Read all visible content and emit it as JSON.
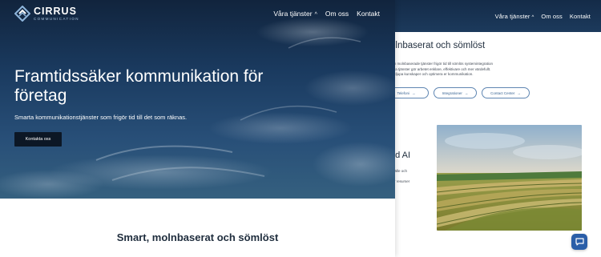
{
  "front": {
    "logo": {
      "name": "CIRRUS",
      "tagline": "COMMUNICATION"
    },
    "nav": {
      "services": "Våra tjänster",
      "about": "Om oss",
      "contact": "Kontakt"
    },
    "hero": {
      "title": "Framtidssäker kommunikation för företag",
      "lead": "Smarta kommunikationstjänster som frigör tid till det som räknas.",
      "cta": "Kontakta oss"
    },
    "section_title": "Smart, molnbaserat och sömlöst"
  },
  "back": {
    "nav": {
      "services": "Våra tjänster",
      "about": "Om oss",
      "contact": "Kontakt"
    },
    "heading": "olnbaserat och sömlöst",
    "body_lines": [
      "och molnbaserade tjänster frigör tid till sömlös systemintegration",
      "våra tjänster gör arbetet enklare, effektivare och mer värdefullt.",
      "fördjupa kunskaper och optimera er kommunikation."
    ],
    "links": [
      "Telefoni",
      "Integrationer",
      "Contact Center"
    ],
    "side_title": "ed AI",
    "side_body": [
      "tillfälle och",
      "gör resurser"
    ]
  },
  "colors": {
    "hero_dark": "#11243d",
    "accent": "#5f86b2",
    "cta": "#0c1725",
    "chat": "#2a5ea8"
  },
  "icons": {
    "logo": "cirrus-logo-mark",
    "nav_dropdown": "chevron-up-icon",
    "link_arrow": "arrow-right-icon",
    "chat": "chat-bubble-icon"
  }
}
